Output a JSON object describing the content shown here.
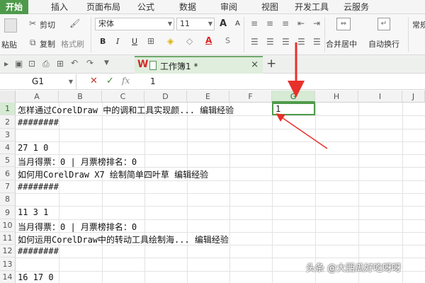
{
  "menu_tabs": [
    "开始",
    "插入",
    "页面布局",
    "公式",
    "数据",
    "审阅",
    "视图",
    "开发工具",
    "云服务"
  ],
  "ribbon": {
    "paste": "粘贴",
    "cut": "剪切",
    "copy": "复制",
    "format_painter": "格式刷",
    "font_name": "宋体",
    "font_size": "11",
    "grow": "A",
    "shrink": "A",
    "bold": "B",
    "italic": "I",
    "underline": "U",
    "merge_center": "合并居中",
    "wrap_text": "自动换行",
    "number_format": "常规"
  },
  "doc_tab": {
    "title": "工作簿1 *",
    "close": "×",
    "new_tab": "+"
  },
  "formula_bar": {
    "name_box": "G1",
    "cancel": "✕",
    "confirm": "✓",
    "fx": "fx",
    "value": "1"
  },
  "columns": [
    "A",
    "B",
    "C",
    "D",
    "E",
    "F",
    "G",
    "H",
    "I",
    "J"
  ],
  "rows": [
    "1",
    "2",
    "3",
    "4",
    "5",
    "6",
    "7",
    "8",
    "9",
    "10",
    "11",
    "12",
    "13",
    "14"
  ],
  "cells": {
    "A1": "怎样通过CorelDraw 中的调和工具实现颜... 编辑经验",
    "A2": "########",
    "A4": "27 1 0",
    "A5": "当月得票：0 | 月票榜排名：0",
    "A6": "如何用CorelDraw X7 绘制简单四叶草 编辑经验",
    "A7": "########",
    "A9": "11 3 1",
    "A10": "当月得票：0 | 月票榜排名：0",
    "A11": "如何运用CorelDraw中的转动工具绘制海... 编辑经验",
    "A12": "########",
    "A14": "16 17 0",
    "G1": "1"
  },
  "watermark": "头条 @大西瓜好吃呀呀",
  "colors": {
    "accent_green": "#4e9a4b",
    "arrow_red": "#e8302a"
  }
}
